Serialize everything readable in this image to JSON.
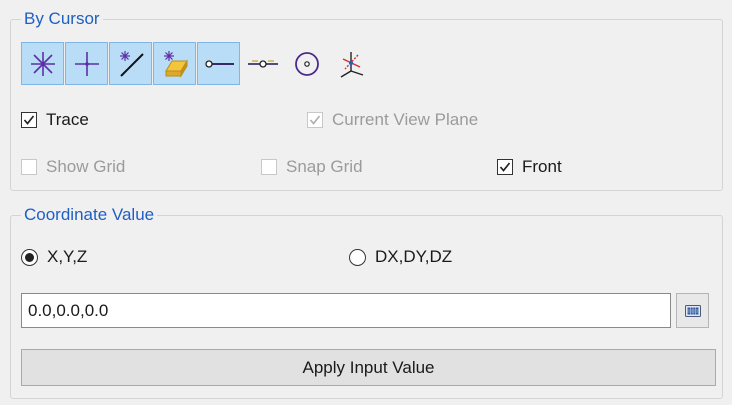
{
  "by_cursor": {
    "title": "By Cursor",
    "tools": [
      {
        "icon": "point-star-icon",
        "selected": true
      },
      {
        "icon": "point-cross-icon",
        "selected": true
      },
      {
        "icon": "point-on-line-icon",
        "selected": true
      },
      {
        "icon": "point-on-face-icon",
        "selected": true
      },
      {
        "icon": "line-endpoint-icon",
        "selected": true
      },
      {
        "icon": "line-midpoint-icon",
        "selected": false
      },
      {
        "icon": "circle-center-icon",
        "selected": false
      },
      {
        "icon": "axis-intersection-icon",
        "selected": false
      }
    ],
    "trace": {
      "label": "Trace",
      "checked": true,
      "enabled": true
    },
    "current_view_plane": {
      "label": "Current View Plane",
      "checked": true,
      "enabled": false
    },
    "show_grid": {
      "label": "Show Grid",
      "checked": false,
      "enabled": false
    },
    "snap_grid": {
      "label": "Snap Grid",
      "checked": false,
      "enabled": false
    },
    "front": {
      "label": "Front",
      "checked": true,
      "enabled": true
    }
  },
  "coordinate_value": {
    "title": "Coordinate Value",
    "radio_xyz": {
      "label": "X,Y,Z",
      "selected": true
    },
    "radio_dxdydz": {
      "label": "DX,DY,DZ",
      "selected": false
    },
    "input_value": "0.0,0.0,0.0",
    "keypad_icon": "keypad-icon",
    "apply_label": "Apply Input Value"
  },
  "colors": {
    "accent": "#1f5fc4",
    "selected_tool_bg": "#b9dcf7"
  }
}
